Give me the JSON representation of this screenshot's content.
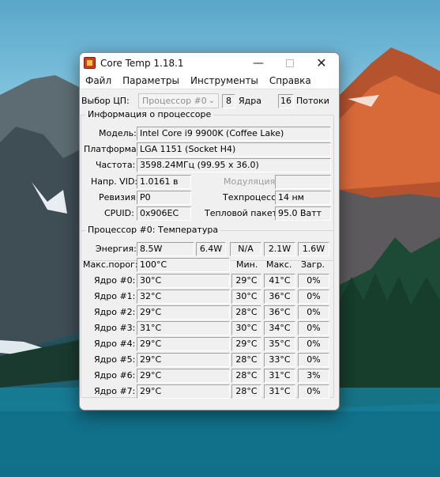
{
  "window": {
    "title": "Core Temp 1.18.1",
    "icon": "core-temp-app-icon",
    "controls": {
      "minimize": "—",
      "close": "✕"
    }
  },
  "menu": [
    "Файл",
    "Параметры",
    "Инструменты",
    "Справка"
  ],
  "cpu_select": {
    "label": "Выбор ЦП:",
    "value": "Процессор #0",
    "cores_value": "8",
    "cores_label": "Ядра",
    "threads_value": "16",
    "threads_label": "Потоки"
  },
  "info": {
    "title": "Информация о процессоре",
    "model_label": "Модель:",
    "model": "Intel Core i9 9900K (Coffee Lake)",
    "platform_label": "Платформа:",
    "platform": "LGA 1151 (Socket H4)",
    "frequency_label": "Частота:",
    "frequency": "3598.24МГц (99.95 x 36.0)",
    "vid_label": "Напр. VID:",
    "vid": "1.0161 в",
    "modulation_label": "Модуляция:",
    "modulation": "",
    "revision_label": "Ревизия:",
    "revision": "P0",
    "process_label": "Техпроцесс:",
    "process": "14 нм",
    "cpuid_label": "CPUID:",
    "cpuid": "0x906EC",
    "tdp_label": "Тепловой пакет:",
    "tdp": "95.0 Ватт"
  },
  "temps": {
    "title": "Процессор #0: Температура",
    "power_label": "Энергия:",
    "power": [
      "8.5W",
      "6.4W",
      "N/A",
      "2.1W",
      "1.6W"
    ],
    "tjmax_label": "Макс.порог:",
    "tjmax": "100°C",
    "col_min": "Мин.",
    "col_max": "Макс.",
    "col_load": "Загр.",
    "cores": [
      {
        "label": "Ядро #0:",
        "temp": "30°C",
        "min": "29°C",
        "max": "41°C",
        "load": "0%"
      },
      {
        "label": "Ядро #1:",
        "temp": "32°C",
        "min": "30°C",
        "max": "36°C",
        "load": "0%"
      },
      {
        "label": "Ядро #2:",
        "temp": "29°C",
        "min": "28°C",
        "max": "36°C",
        "load": "0%"
      },
      {
        "label": "Ядро #3:",
        "temp": "31°C",
        "min": "30°C",
        "max": "34°C",
        "load": "0%"
      },
      {
        "label": "Ядро #4:",
        "temp": "29°C",
        "min": "29°C",
        "max": "35°C",
        "load": "0%"
      },
      {
        "label": "Ядро #5:",
        "temp": "29°C",
        "min": "28°C",
        "max": "33°C",
        "load": "0%"
      },
      {
        "label": "Ядро #6:",
        "temp": "29°C",
        "min": "28°C",
        "max": "31°C",
        "load": "3%"
      },
      {
        "label": "Ядро #7:",
        "temp": "29°C",
        "min": "28°C",
        "max": "31°C",
        "load": "0%"
      }
    ]
  },
  "colors": {
    "window_bg": "#f0f0f0",
    "titlebar_bg": "#ffffff",
    "disabled_text": "#9a9a9a"
  }
}
